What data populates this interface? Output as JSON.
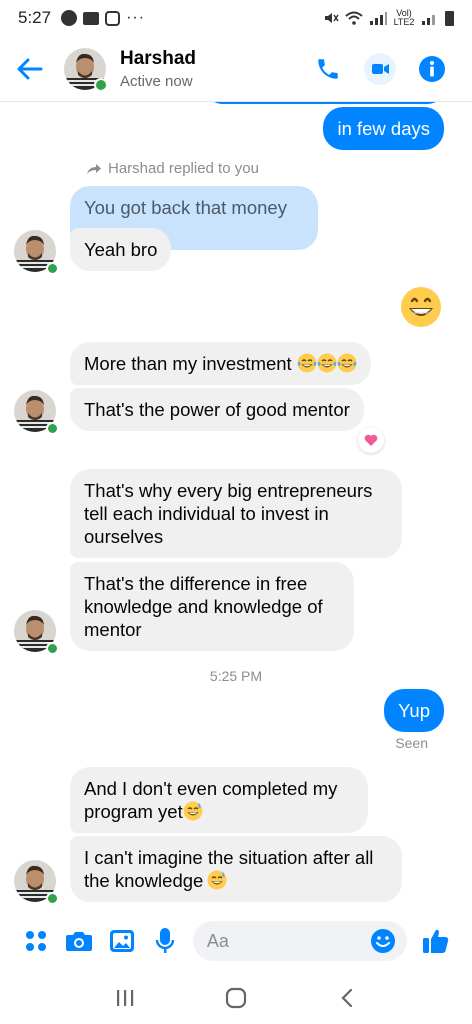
{
  "status_bar": {
    "time": "5:27",
    "more": "···",
    "network": "Vol) LTE2"
  },
  "header": {
    "contact_name": "Harshad",
    "status": "Active now",
    "icons": [
      "back-arrow-icon",
      "phone-icon",
      "video-call-icon",
      "info-icon"
    ],
    "accent_color": "#0084ff",
    "online_color": "#31a24c"
  },
  "messages": {
    "out_1": "in few days",
    "reply_note": "Harshad replied to you",
    "quoted": "You got back that money",
    "in_1": "Yeah bro",
    "emoji_reply": "grinning-face-emoji",
    "in_2": "More than my investment",
    "in_2_emoji": "joy-emoji",
    "in_3": "That's the power of good mentor",
    "in_3_reaction": "heart-reaction",
    "in_4": "That's why every big entrepreneurs tell each individual to invest in ourselves",
    "in_5": "That's the difference in free knowledge and knowledge of mentor",
    "timestamp": "5:25 PM",
    "out_2": "Yup",
    "seen": "Seen",
    "in_6": "And I don't even completed my program yet",
    "in_7": "I can't imagine the situation after all the knowledge"
  },
  "composer": {
    "placeholder": "Aa",
    "icons": [
      "menu-dots-icon",
      "camera-icon",
      "gallery-icon",
      "microphone-icon",
      "emoji-icon",
      "thumbs-up-icon"
    ]
  },
  "nav": {
    "icons": [
      "recents-icon",
      "home-icon",
      "back-icon"
    ]
  },
  "colors": {
    "outgoing_bubble": "#0084ff",
    "incoming_bubble": "#f0f0f0",
    "quoted_bubble": "#c9e3fc"
  }
}
